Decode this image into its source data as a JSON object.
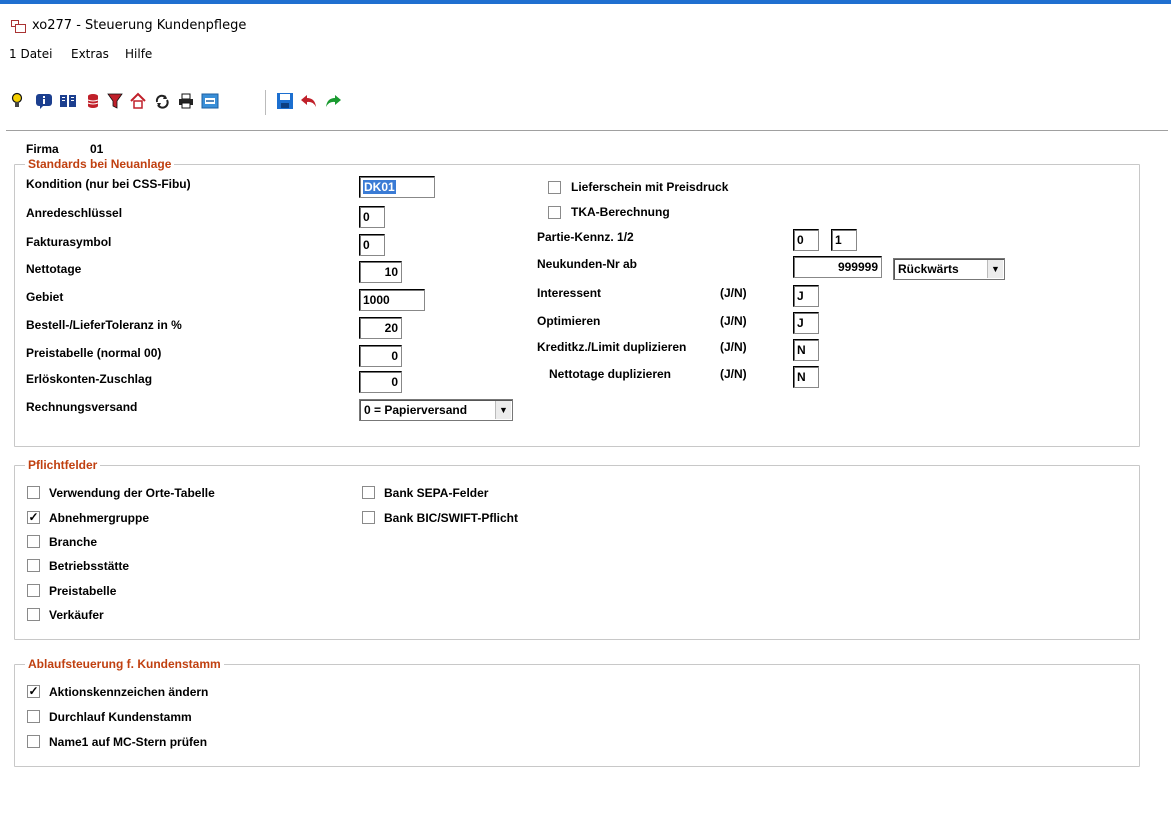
{
  "window": {
    "title": "xo277 - Steuerung Kundenpflege"
  },
  "menu": {
    "items": [
      "1 Datei",
      "Extras",
      "Hilfe"
    ]
  },
  "toolbar": {
    "icons": [
      "lightbulb-icon",
      "info-icon",
      "book-icon",
      "database-icon",
      "filter-icon",
      "home-icon",
      "refresh-icon",
      "print-icon",
      "resize-icon",
      "save-icon",
      "undo-icon",
      "redo-icon"
    ]
  },
  "header": {
    "firma_label": "Firma",
    "firma_value": "01"
  },
  "standards": {
    "legend": "Standards bei Neuanlage",
    "kondition": {
      "label": "Kondition (nur bei CSS-Fibu)",
      "value": "DK01"
    },
    "anrede": {
      "label": "Anredeschlüssel",
      "value": "0"
    },
    "faktura": {
      "label": "Fakturasymbol",
      "value": "0"
    },
    "nettotage": {
      "label": "Nettotage",
      "value": "10"
    },
    "gebiet": {
      "label": "Gebiet",
      "value": "1000"
    },
    "toleranz": {
      "label": "Bestell-/LieferToleranz in %",
      "value": "20"
    },
    "preistabelle": {
      "label": "Preistabelle (normal 00)",
      "value": "0"
    },
    "erloes": {
      "label": "Erlöskonten-Zuschlag",
      "value": "0"
    },
    "rechnungsversand": {
      "label": "Rechnungsversand",
      "value": "0 = Papierversand"
    },
    "lieferschein": {
      "label": "Lieferschein mit Preisdruck",
      "checked": false
    },
    "tka": {
      "label": "TKA-Berechnung",
      "checked": false
    },
    "partie": {
      "label": "Partie-Kennz. 1/2",
      "value1": "0",
      "value2": "1"
    },
    "neukunden": {
      "label": "Neukunden-Nr ab",
      "value": "999999",
      "direction": "Rückwärts"
    },
    "interessent": {
      "label": "Interessent",
      "hint": "(J/N)",
      "value": "J"
    },
    "optimieren": {
      "label": "Optimieren",
      "hint": "(J/N)",
      "value": "J"
    },
    "kredit": {
      "label": "Kreditkz./Limit duplizieren",
      "hint": "(J/N)",
      "value": "N"
    },
    "nettodup": {
      "label": "Nettotage duplizieren",
      "hint": "(J/N)",
      "value": "N"
    }
  },
  "pflicht": {
    "legend": "Pflichtfelder",
    "items": [
      {
        "label": "Verwendung der Orte-Tabelle",
        "checked": false
      },
      {
        "label": "Abnehmergruppe",
        "checked": true
      },
      {
        "label": "Branche",
        "checked": false
      },
      {
        "label": "Betriebsstätte",
        "checked": false
      },
      {
        "label": "Preistabelle",
        "checked": false
      },
      {
        "label": "Verkäufer",
        "checked": false
      },
      {
        "label": "Bank SEPA-Felder",
        "checked": false
      },
      {
        "label": "Bank BIC/SWIFT-Pflicht",
        "checked": false
      }
    ]
  },
  "ablauf": {
    "legend": "Ablaufsteuerung f. Kundenstamm",
    "items": [
      {
        "label": "Aktionskennzeichen ändern",
        "checked": true
      },
      {
        "label": "Durchlauf Kundenstamm",
        "checked": false
      },
      {
        "label": "Name1 auf MC-Stern prüfen",
        "checked": false
      }
    ]
  },
  "colors": {
    "legend": "#c04010",
    "accent": "#1f6fd0",
    "selection": "#3a7bd5"
  }
}
